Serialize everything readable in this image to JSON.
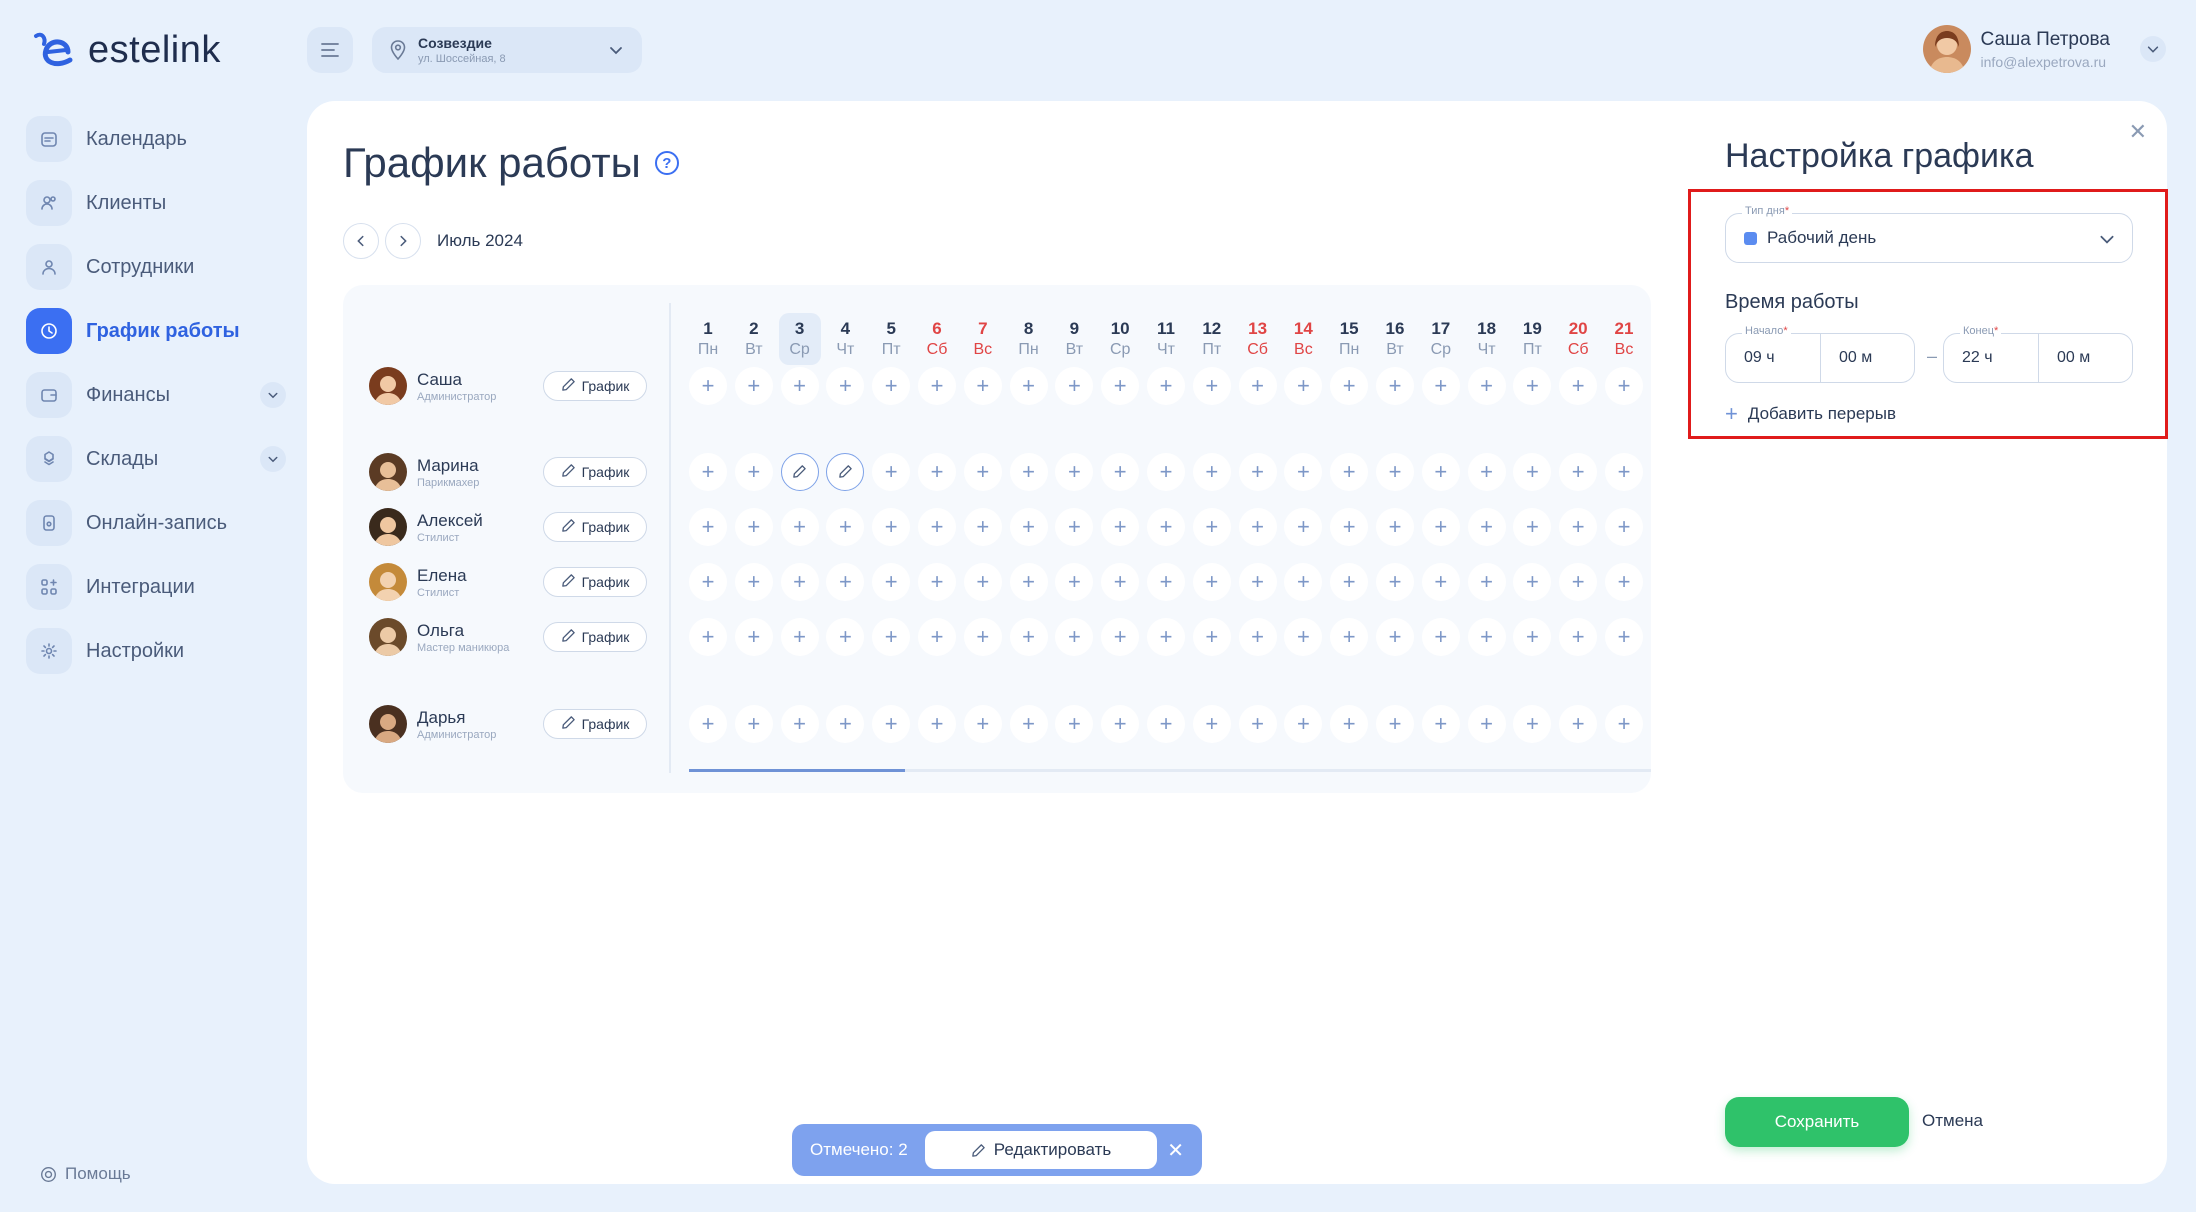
{
  "brand": {
    "name": "estelink"
  },
  "sidebar": {
    "items": [
      {
        "label": "Календарь",
        "icon": "calendar-icon",
        "active": false,
        "expandable": false
      },
      {
        "label": "Клиенты",
        "icon": "clients-icon",
        "active": false,
        "expandable": false
      },
      {
        "label": "Сотрудники",
        "icon": "staff-icon",
        "active": false,
        "expandable": false
      },
      {
        "label": "График работы",
        "icon": "clock-icon",
        "active": true,
        "expandable": false
      },
      {
        "label": "Финансы",
        "icon": "wallet-icon",
        "active": false,
        "expandable": true
      },
      {
        "label": "Склады",
        "icon": "boxes-icon",
        "active": false,
        "expandable": true
      },
      {
        "label": "Онлайн-запись",
        "icon": "phone-icon",
        "active": false,
        "expandable": false
      },
      {
        "label": "Интеграции",
        "icon": "grid-plus-icon",
        "active": false,
        "expandable": false
      },
      {
        "label": "Настройки",
        "icon": "gear-icon",
        "active": false,
        "expandable": false
      }
    ],
    "help_label": "Помощь"
  },
  "header": {
    "location": {
      "name": "Созвездие",
      "address": "ул. Шоссейная, 8"
    },
    "user": {
      "name": "Саша Петрова",
      "email": "info@alexpetrova.ru"
    }
  },
  "page": {
    "title": "График работы",
    "month": "Июль 2024",
    "schedule_button_label": "График"
  },
  "days": [
    {
      "num": "1",
      "wd": "Пн",
      "weekend": false
    },
    {
      "num": "2",
      "wd": "Вт",
      "weekend": false
    },
    {
      "num": "3",
      "wd": "Ср",
      "weekend": false,
      "today": true
    },
    {
      "num": "4",
      "wd": "Чт",
      "weekend": false
    },
    {
      "num": "5",
      "wd": "Пт",
      "weekend": false
    },
    {
      "num": "6",
      "wd": "Сб",
      "weekend": true
    },
    {
      "num": "7",
      "wd": "Вс",
      "weekend": true
    },
    {
      "num": "8",
      "wd": "Пн",
      "weekend": false
    },
    {
      "num": "9",
      "wd": "Вт",
      "weekend": false
    },
    {
      "num": "10",
      "wd": "Ср",
      "weekend": false
    },
    {
      "num": "11",
      "wd": "Чт",
      "weekend": false
    },
    {
      "num": "12",
      "wd": "Пт",
      "weekend": false
    },
    {
      "num": "13",
      "wd": "Сб",
      "weekend": true
    },
    {
      "num": "14",
      "wd": "Вс",
      "weekend": true
    },
    {
      "num": "15",
      "wd": "Пн",
      "weekend": false
    },
    {
      "num": "16",
      "wd": "Вт",
      "weekend": false
    },
    {
      "num": "17",
      "wd": "Ср",
      "weekend": false
    },
    {
      "num": "18",
      "wd": "Чт",
      "weekend": false
    },
    {
      "num": "19",
      "wd": "Пт",
      "weekend": false
    },
    {
      "num": "20",
      "wd": "Сб",
      "weekend": true
    },
    {
      "num": "21",
      "wd": "Вс",
      "weekend": true
    }
  ],
  "employees": [
    {
      "name": "Саша",
      "role": "Администратор",
      "selected_days": []
    },
    {
      "name": "Марина",
      "role": "Парикмахер",
      "selected_days": [
        3,
        4
      ]
    },
    {
      "name": "Алексей",
      "role": "Стилист",
      "selected_days": []
    },
    {
      "name": "Елена",
      "role": "Стилист",
      "selected_days": []
    },
    {
      "name": "Ольга",
      "role": "Мастер маникюра",
      "selected_days": []
    },
    {
      "name": "Дарья",
      "role": "Администратор",
      "selected_days": []
    }
  ],
  "panel": {
    "title": "Настройка графика",
    "day_type": {
      "label": "Тип дня",
      "value": "Рабочий день",
      "color": "#5b8cf0"
    },
    "work_time_title": "Время работы",
    "start": {
      "label": "Начало",
      "hours": "09 ч",
      "minutes": "00 м"
    },
    "end": {
      "label": "Конец",
      "hours": "22 ч",
      "minutes": "00 м"
    },
    "add_break_label": "Добавить перерыв",
    "save_label": "Сохранить",
    "cancel_label": "Отмена"
  },
  "selection_bar": {
    "count_label": "Отмечено: 2",
    "edit_label": "Редактировать"
  },
  "colors": {
    "accent": "#3b6ff2",
    "save": "#2fc26a",
    "weekend": "#e04545",
    "highlight": "#e01b1b"
  }
}
